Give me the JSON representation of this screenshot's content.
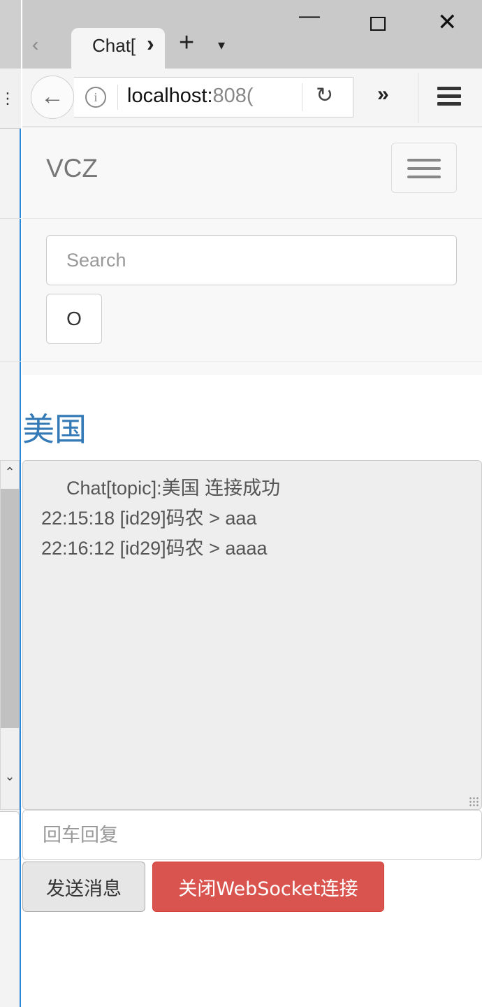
{
  "browser": {
    "tab_title": "Chat[",
    "url_host": "localhost:",
    "url_port": "808(",
    "icons": {
      "back": "arrow-left-icon",
      "info": "info-icon",
      "reload": "reload-icon",
      "overflow": "chevron-double-right-icon",
      "menu": "hamburger-menu-icon",
      "new_tab": "plus-icon",
      "tab_list": "caret-down-icon",
      "minimize": "minimize-icon",
      "maximize": "maximize-icon",
      "close": "close-icon"
    }
  },
  "navbar": {
    "brand": "VCZ",
    "search_placeholder": "Search",
    "search_button": "O"
  },
  "chat": {
    "topic": "美国",
    "messages": [
      "Chat[topic]:美国  连接成功",
      "22:15:18 [id29]码农 > aaa",
      "22:16:12 [id29]码农 > aaaa"
    ],
    "reply_placeholder": "回车回复",
    "send_label": "发送消息",
    "close_label": "关闭WebSocket连接"
  },
  "colors": {
    "topic": "#337ab7",
    "danger": "#d9534f",
    "log_bg": "#eeeeee"
  }
}
